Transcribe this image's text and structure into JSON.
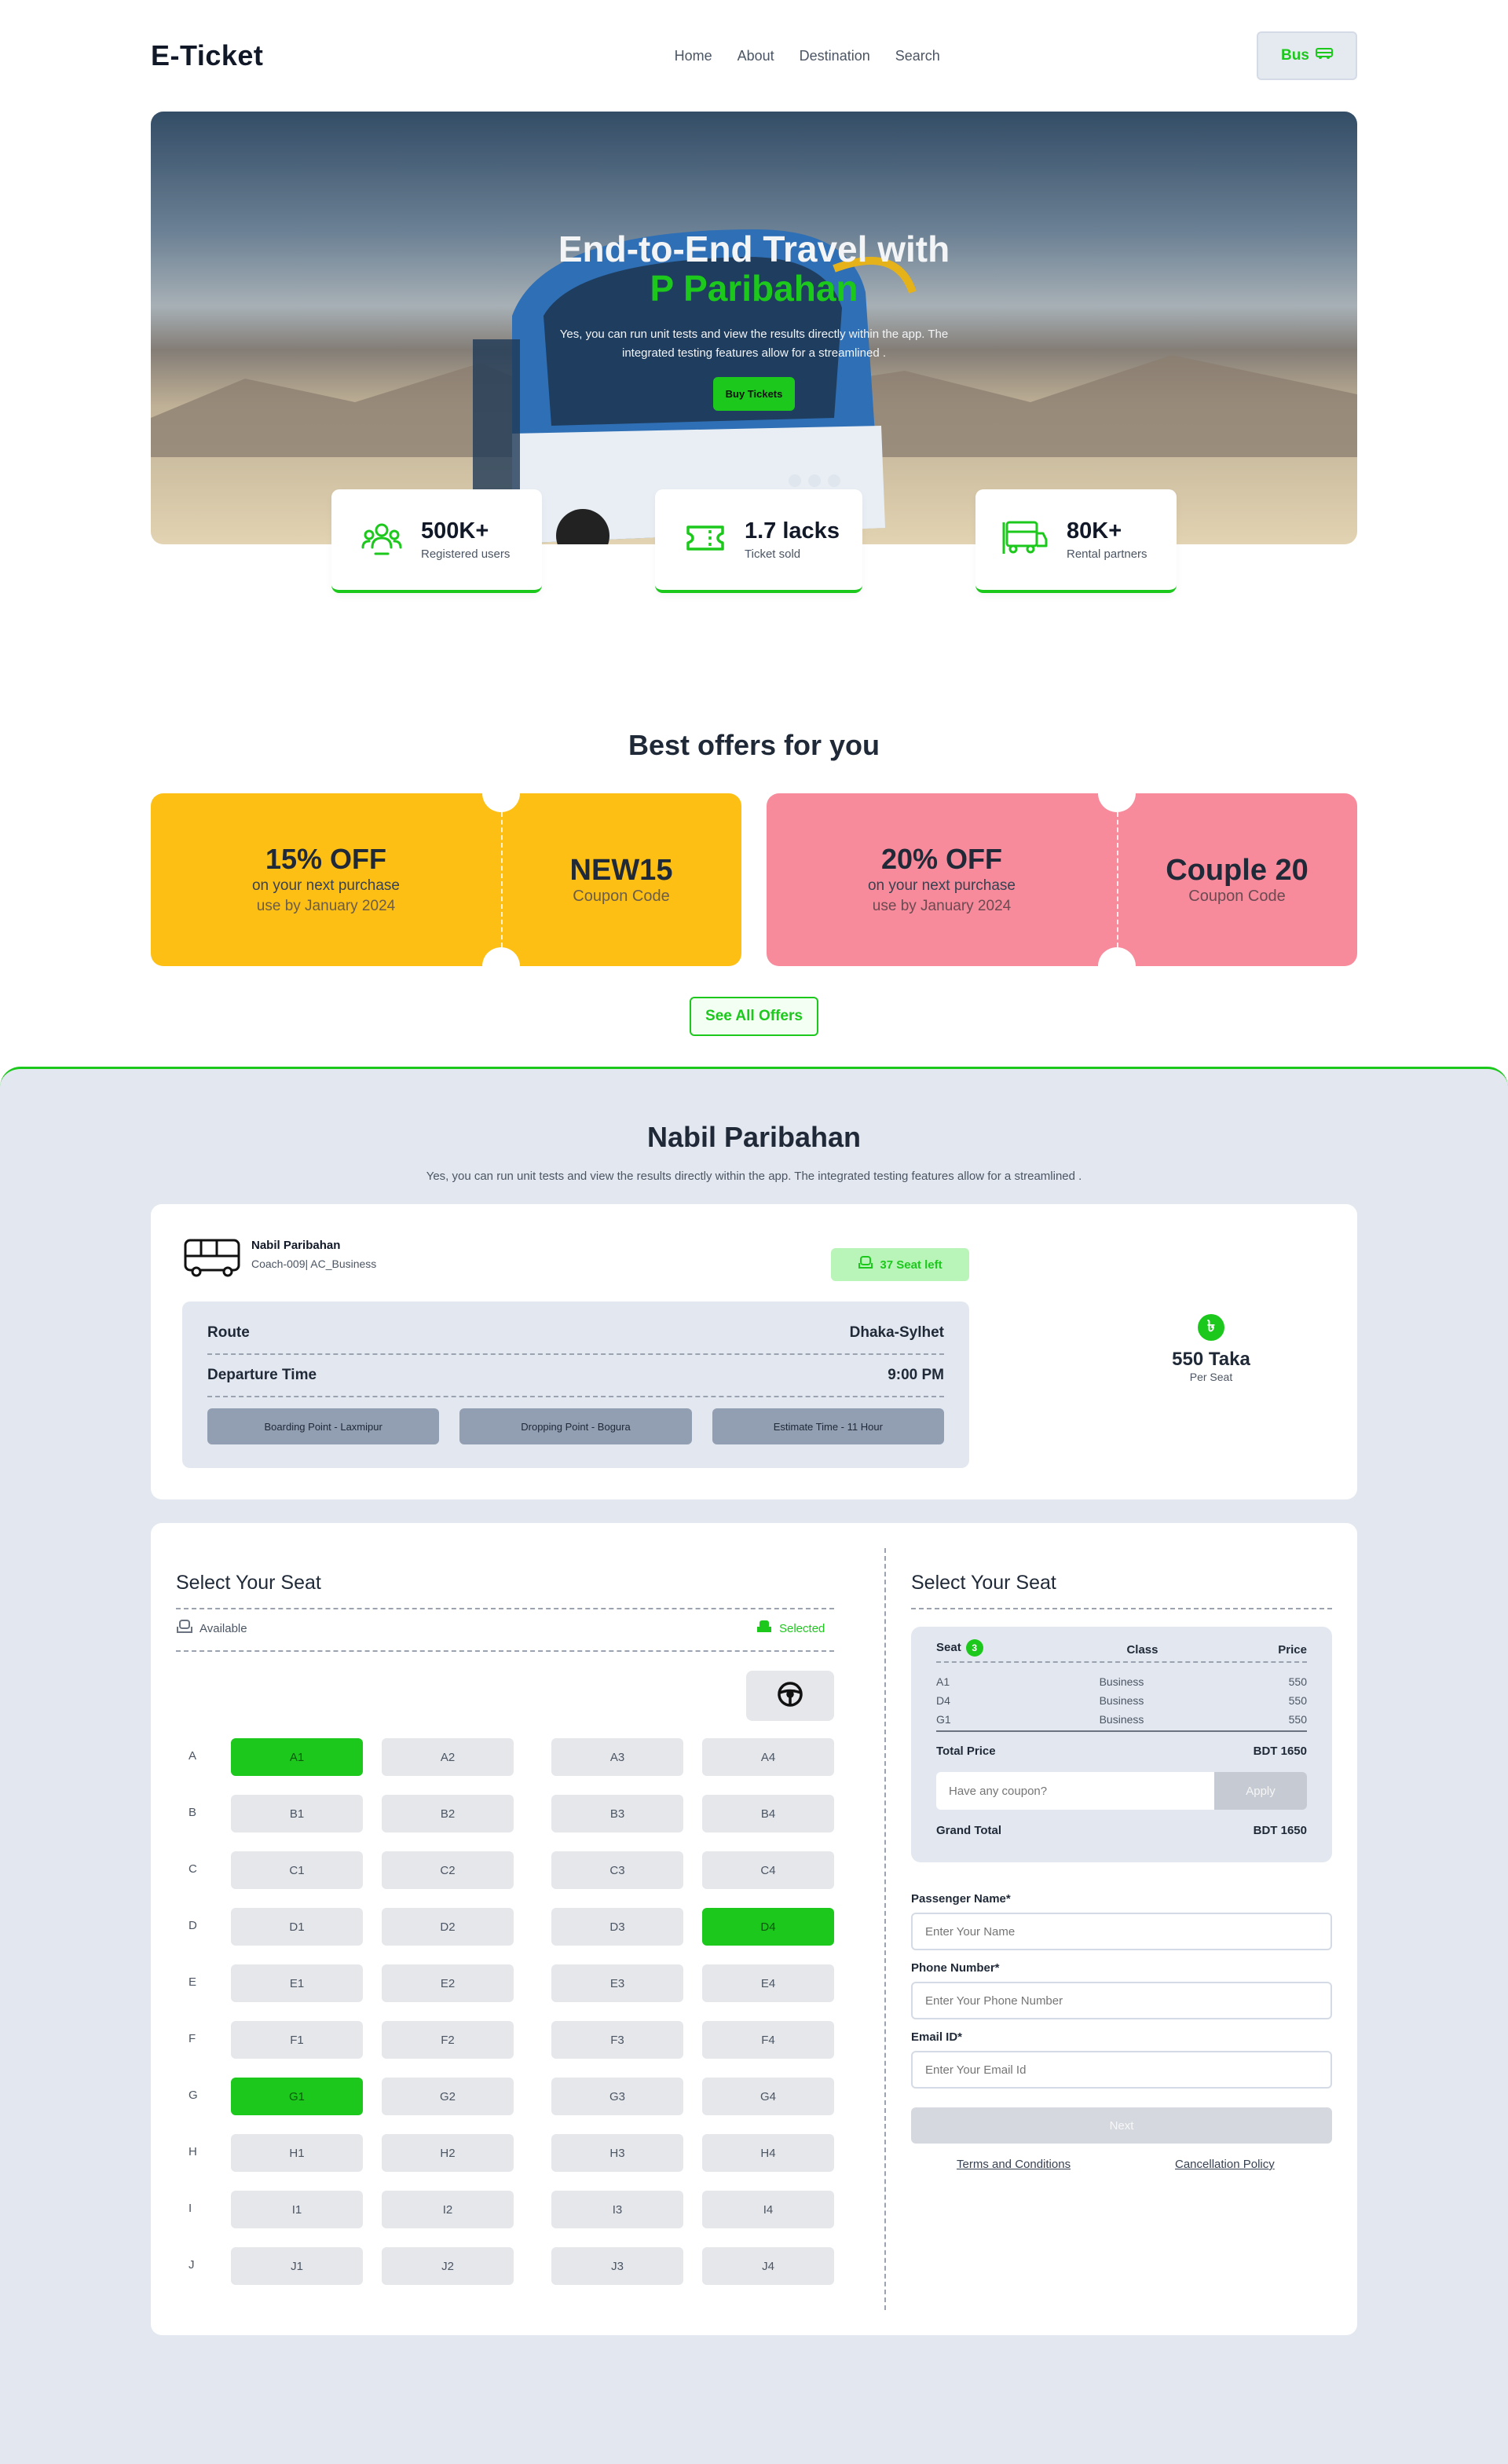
{
  "nav": {
    "logo": "E-Ticket",
    "links": [
      "Home",
      "About",
      "Destination",
      "Search"
    ],
    "bus_button": "Bus",
    "bus_icon": "bus-icon"
  },
  "hero": {
    "title_line1": "End-to-End Travel with",
    "title_line2": "P Paribahan",
    "subtitle": "Yes, you can run unit tests and view the results directly within the app. The integrated testing features allow for a streamlined .",
    "cta": "Buy Tickets"
  },
  "stats": [
    {
      "value": "500K+",
      "label": "Registered users",
      "icon": "users-icon"
    },
    {
      "value": "1.7 lacks",
      "label": "Ticket sold",
      "icon": "ticket-icon"
    },
    {
      "value": "80K+",
      "label": "Rental partners",
      "icon": "bus-rental-icon"
    }
  ],
  "offers": {
    "title": "Best offers for you",
    "items": [
      {
        "discount": "15% OFF",
        "line1": "on your next purchase",
        "line2": "use by January 2024",
        "code": "NEW15",
        "code_label": "Coupon Code",
        "color": "#fdbf14"
      },
      {
        "discount": "20% OFF",
        "line1": "on your next purchase",
        "line2": "use by January 2024",
        "code": "Couple 20",
        "code_label": "Coupon Code",
        "color": "#f78b9b"
      }
    ],
    "see_all": "See All Offers"
  },
  "booking": {
    "title": "Nabil Paribahan",
    "subtitle": "Yes, you can run unit tests and view the results directly within the app. The integrated testing features allow for a streamlined .",
    "operator": "Nabil Paribahan",
    "coach": "Coach-009| AC_Business",
    "seats_left": "37 Seat left",
    "route_label": "Route",
    "route_value": "Dhaka-Sylhet",
    "departure_label": "Departure Time",
    "departure_value": "9:00 PM",
    "boarding": "Boarding Point - Laxmipur",
    "dropping": "Dropping Point - Bogura",
    "estimate": "Estimate Time - 11 Hour",
    "currency_symbol": "৳",
    "price": "550 Taka",
    "price_per": "Per Seat"
  },
  "seat_map": {
    "title": "Select Your Seat",
    "legend_available": "Available",
    "legend_selected": "Selected",
    "rows": [
      {
        "label": "A",
        "seats": [
          {
            "id": "A1",
            "selected": true
          },
          {
            "id": "A2",
            "selected": false
          },
          {
            "id": "A3",
            "selected": false
          },
          {
            "id": "A4",
            "selected": false
          }
        ]
      },
      {
        "label": "B",
        "seats": [
          {
            "id": "B1",
            "selected": false
          },
          {
            "id": "B2",
            "selected": false
          },
          {
            "id": "B3",
            "selected": false
          },
          {
            "id": "B4",
            "selected": false
          }
        ]
      },
      {
        "label": "C",
        "seats": [
          {
            "id": "C1",
            "selected": false
          },
          {
            "id": "C2",
            "selected": false
          },
          {
            "id": "C3",
            "selected": false
          },
          {
            "id": "C4",
            "selected": false
          }
        ]
      },
      {
        "label": "D",
        "seats": [
          {
            "id": "D1",
            "selected": false
          },
          {
            "id": "D2",
            "selected": false
          },
          {
            "id": "D3",
            "selected": false
          },
          {
            "id": "D4",
            "selected": true
          }
        ]
      },
      {
        "label": "E",
        "seats": [
          {
            "id": "E1",
            "selected": false
          },
          {
            "id": "E2",
            "selected": false
          },
          {
            "id": "E3",
            "selected": false
          },
          {
            "id": "E4",
            "selected": false
          }
        ]
      },
      {
        "label": "F",
        "seats": [
          {
            "id": "F1",
            "selected": false
          },
          {
            "id": "F2",
            "selected": false
          },
          {
            "id": "F3",
            "selected": false
          },
          {
            "id": "F4",
            "selected": false
          }
        ]
      },
      {
        "label": "G",
        "seats": [
          {
            "id": "G1",
            "selected": true
          },
          {
            "id": "G2",
            "selected": false
          },
          {
            "id": "G3",
            "selected": false
          },
          {
            "id": "G4",
            "selected": false
          }
        ]
      },
      {
        "label": "H",
        "seats": [
          {
            "id": "H1",
            "selected": false
          },
          {
            "id": "H2",
            "selected": false
          },
          {
            "id": "H3",
            "selected": false
          },
          {
            "id": "H4",
            "selected": false
          }
        ]
      },
      {
        "label": "I",
        "seats": [
          {
            "id": "I1",
            "selected": false
          },
          {
            "id": "I2",
            "selected": false
          },
          {
            "id": "I3",
            "selected": false
          },
          {
            "id": "I4",
            "selected": false
          }
        ]
      },
      {
        "label": "J",
        "seats": [
          {
            "id": "J1",
            "selected": false
          },
          {
            "id": "J2",
            "selected": false
          },
          {
            "id": "J3",
            "selected": false
          },
          {
            "id": "J4",
            "selected": false
          }
        ]
      }
    ]
  },
  "summary": {
    "title": "Select Your Seat",
    "col_seat": "Seat",
    "seat_count": "3",
    "col_class": "Class",
    "col_price": "Price",
    "items": [
      {
        "seat": "A1",
        "class": "Business",
        "price": "550"
      },
      {
        "seat": "D4",
        "class": "Business",
        "price": "550"
      },
      {
        "seat": "G1",
        "class": "Business",
        "price": "550"
      }
    ],
    "total_label": "Total Price",
    "total_value": "BDT 1650",
    "coupon_placeholder": "Have any coupon?",
    "apply": "Apply",
    "grand_label": "Grand Total",
    "grand_value": "BDT 1650"
  },
  "form": {
    "name_label": "Passenger Name*",
    "name_placeholder": "Enter Your Name",
    "phone_label": "Phone Number*",
    "phone_placeholder": "Enter Your Phone Number",
    "email_label": "Email ID*",
    "email_placeholder": "Enter Your Email Id",
    "next": "Next",
    "terms": "Terms and Conditions",
    "cancellation": "Cancellation Policy"
  },
  "colors": {
    "accent": "#1dc81d",
    "section_bg": "#e3e8f0"
  }
}
